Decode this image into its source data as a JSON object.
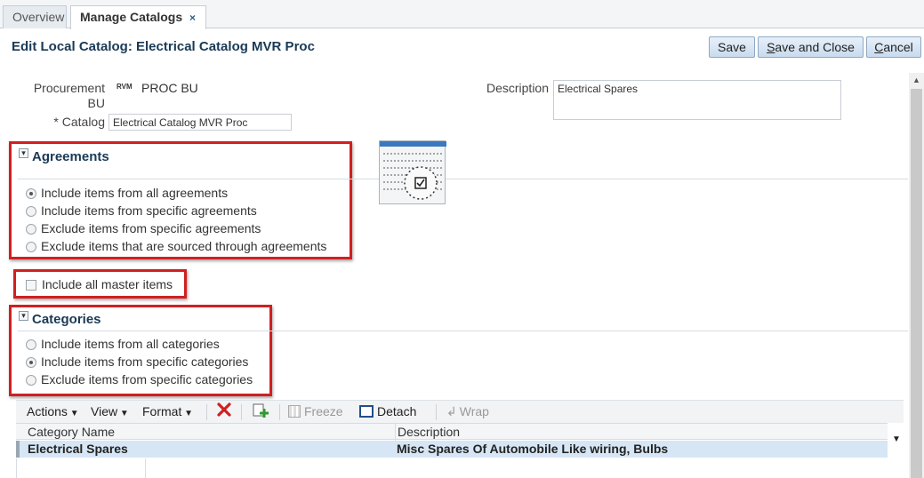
{
  "tabs": [
    {
      "label": "Overview"
    },
    {
      "label": "Manage Catalogs",
      "close_icon": "×"
    }
  ],
  "page": {
    "title": "Edit Local Catalog: Electrical Catalog MVR Proc"
  },
  "buttons": {
    "save": "Save",
    "save_and_close": "Save and Close",
    "cancel": "Cancel"
  },
  "form": {
    "procurement_bu_label": "Procurement BU",
    "procurement_bu_badge": "RVM",
    "procurement_bu_value": "PROC BU",
    "catalog_label": "* Catalog",
    "catalog_value": "Electrical Catalog MVR Proc",
    "description_label": "Description",
    "description_value": "Electrical Spares"
  },
  "agreements": {
    "title": "Agreements",
    "options": [
      {
        "label": "Include items from all agreements",
        "selected": true
      },
      {
        "label": "Include items from specific agreements",
        "selected": false
      },
      {
        "label": "Exclude items from specific agreements",
        "selected": false
      },
      {
        "label": "Exclude items that are sourced through agreements",
        "selected": false
      }
    ]
  },
  "master_items": {
    "label": "Include all master items",
    "checked": false
  },
  "categories": {
    "title": "Categories",
    "options": [
      {
        "label": "Include items from all categories",
        "selected": false
      },
      {
        "label": "Include items from specific categories",
        "selected": true
      },
      {
        "label": "Exclude items from specific categories",
        "selected": false
      }
    ]
  },
  "toolbar": {
    "actions": "Actions",
    "view": "View",
    "format": "Format",
    "freeze": "Freeze",
    "detach": "Detach",
    "wrap": "Wrap"
  },
  "table": {
    "columns": [
      "Category Name",
      "Description"
    ],
    "rows": [
      {
        "category_name": "Electrical Spares",
        "description": "Misc Spares Of Automobile Like wiring, Bulbs"
      }
    ]
  },
  "colors": {
    "accent": "#1a3a56",
    "highlight_border": "#d21f1f",
    "selected_row": "#d6e6f5"
  }
}
